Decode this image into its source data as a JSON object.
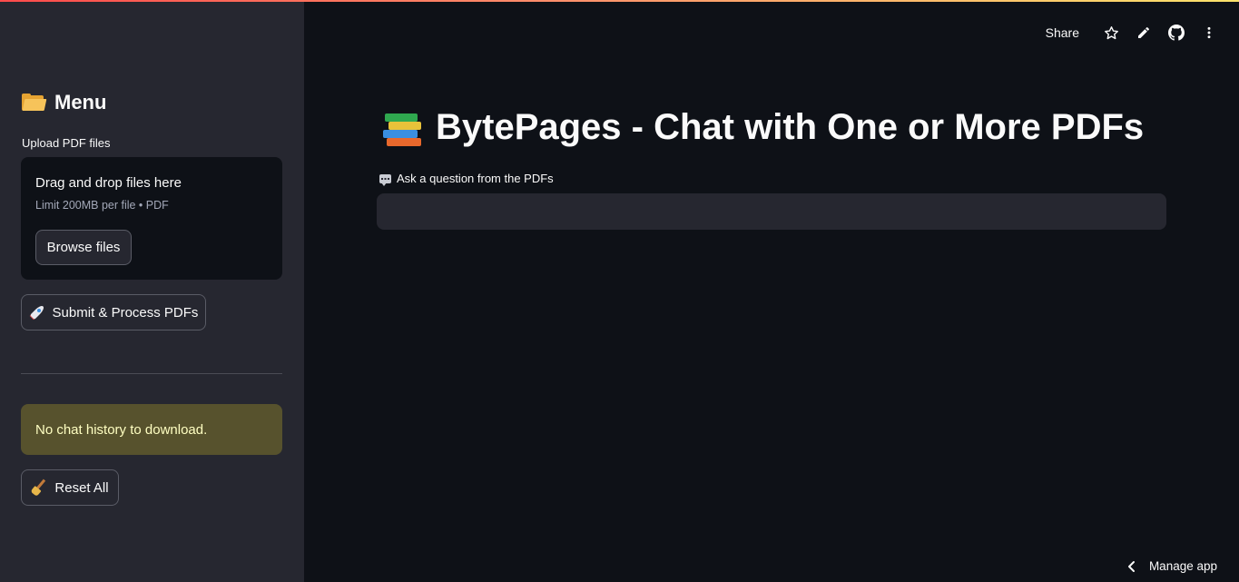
{
  "sidebar": {
    "title": "Menu",
    "title_icon": "folder-icon",
    "upload": {
      "label": "Upload PDF files",
      "dropzone_title": "Drag and drop files here",
      "dropzone_limit": "Limit 200MB per file • PDF",
      "browse_label": "Browse files"
    },
    "submit_label": "Submit & Process PDFs",
    "submit_icon": "rocket-icon",
    "alert_text": "No chat history to download.",
    "reset_label": "Reset All",
    "reset_icon": "broom-icon"
  },
  "toolbar": {
    "share_label": "Share",
    "icons": [
      "star-icon",
      "edit-pencil-icon",
      "github-icon",
      "more-vertical-icon"
    ]
  },
  "main": {
    "title": "BytePages - Chat with One or More PDFs",
    "title_icon": "books-icon",
    "question_label": "Ask a question from the PDFs",
    "question_icon": "speech-balloon-icon",
    "question_value": "",
    "question_placeholder": ""
  },
  "footer": {
    "manage_app_label": "Manage app"
  },
  "colors": {
    "sidebar_bg": "#262730",
    "main_bg": "#0e1117",
    "alert_bg": "#57522d",
    "alert_text": "#ffffc2",
    "accent_gradient_start": "#ff4b4b",
    "accent_gradient_end": "#fde36b"
  }
}
